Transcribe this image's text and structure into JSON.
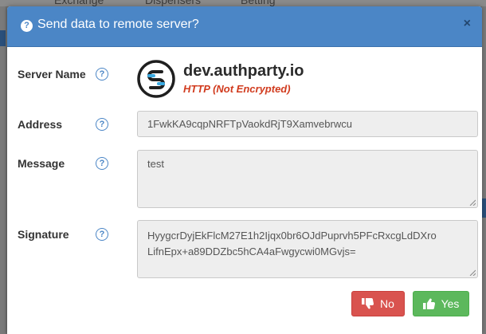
{
  "background": {
    "nav_items": [
      "Exchange",
      "Dispensers",
      "Betting"
    ]
  },
  "modal": {
    "title": "Send data to remote server?",
    "close_label": "×",
    "help_glyph": "?",
    "header_icon": "question-circle-icon",
    "labels": {
      "server_name": "Server Name",
      "address": "Address",
      "message": "Message",
      "signature": "Signature"
    },
    "server": {
      "name": "dev.authparty.io",
      "warning": "HTTP (Not Encrypted)"
    },
    "address": "1FwkKA9cqpNRFTpVaokdRjT9Xamvebrwcu",
    "message": "test",
    "signature_lines": [
      "HyygcrDyjEkFlcM27E1h2Ijqx0br6OJdPuprvh5PFcRxcgLdDXro",
      "LifnEpx+a89DDZbc5hCA4aFwgycwi0MGvjs="
    ],
    "buttons": {
      "no": "No",
      "yes": "Yes"
    }
  },
  "colors": {
    "header": "#4b86c6",
    "danger": "#d9534f",
    "success": "#5cb85c",
    "warning_text": "#d13b1e"
  }
}
